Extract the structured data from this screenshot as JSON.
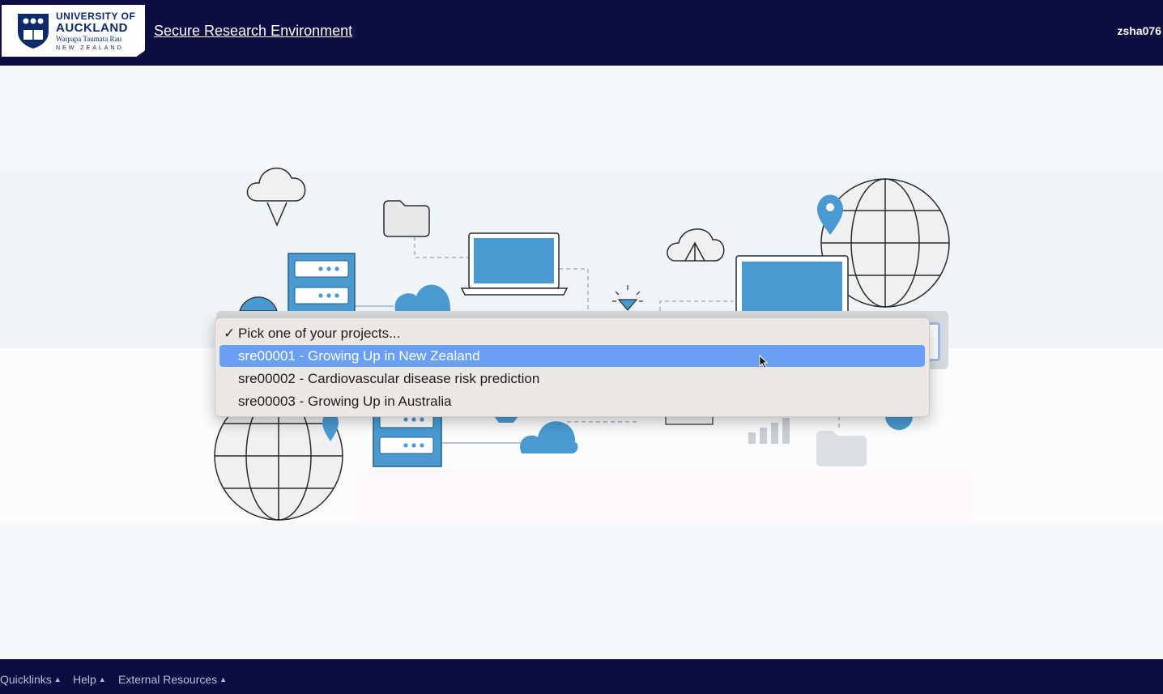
{
  "header": {
    "logo": {
      "line1": "UNIVERSITY OF",
      "line2": "AUCKLAND",
      "line3": "Waipapa Taumata Rau",
      "line4": "NEW ZEALAND"
    },
    "title": "Secure Research Environment",
    "username": "zsha076"
  },
  "project_select": {
    "options": [
      {
        "label": "Pick one of your projects...",
        "checked": true,
        "highlighted": false
      },
      {
        "label": "sre00001 - Growing Up in New Zealand",
        "checked": false,
        "highlighted": true
      },
      {
        "label": "sre00002 - Cardiovascular disease risk prediction",
        "checked": false,
        "highlighted": false
      },
      {
        "label": "sre00003 - Growing Up in Australia",
        "checked": false,
        "highlighted": false
      }
    ],
    "check_glyph": "✓"
  },
  "footer": {
    "items": [
      {
        "label": "Quicklinks"
      },
      {
        "label": "Help"
      },
      {
        "label": "External Resources"
      }
    ],
    "caret": "▲"
  },
  "colors": {
    "navy": "#0d0d44",
    "accent_blue": "#4a9ad1",
    "highlight": "#6aa0f4"
  }
}
